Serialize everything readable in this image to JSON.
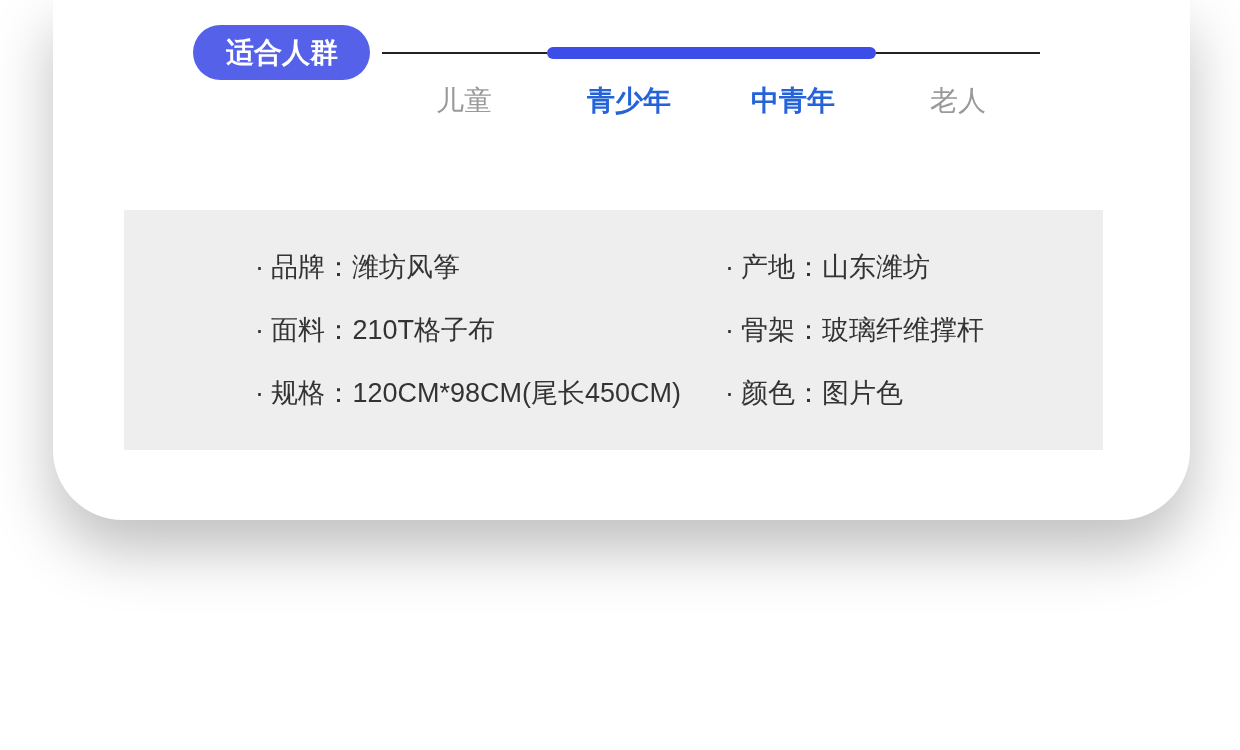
{
  "audience": {
    "label": "适合人群",
    "groups": [
      {
        "label": "儿童",
        "selected": false
      },
      {
        "label": "青少年",
        "selected": true
      },
      {
        "label": "中青年",
        "selected": true
      },
      {
        "label": "老人",
        "selected": false
      }
    ]
  },
  "specs": [
    {
      "text": "· 品牌：潍坊风筝"
    },
    {
      "text": "· 产地：山东潍坊"
    },
    {
      "text": "· 面料：210T格子布"
    },
    {
      "text": "· 骨架：玻璃纤维撑杆"
    },
    {
      "text": "· 规格：120CM*98CM(尾长450CM)"
    },
    {
      "text": "· 颜色：图片色"
    }
  ]
}
